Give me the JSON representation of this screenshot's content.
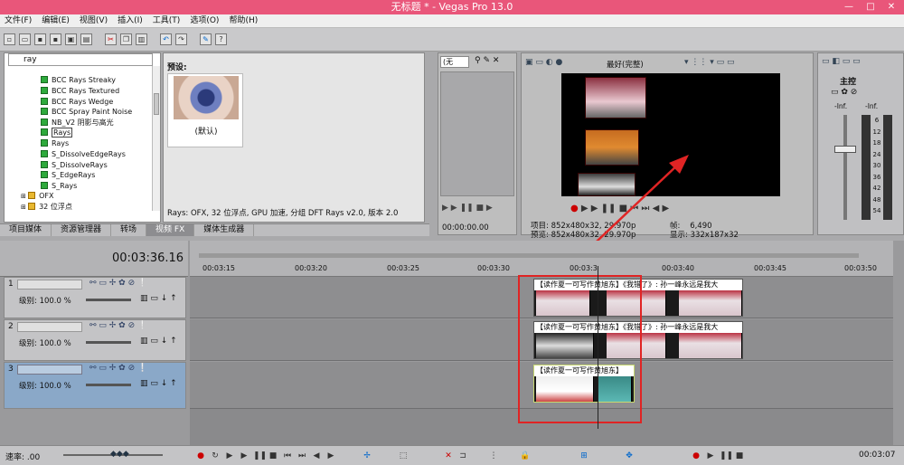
{
  "window": {
    "title": "无标题 * - Vegas Pro 13.0"
  },
  "menu": [
    "文件(F)",
    "编辑(E)",
    "视图(V)",
    "插入(I)",
    "工具(T)",
    "选项(O)",
    "帮助(H)"
  ],
  "explorer": {
    "search_value": "ray",
    "items": [
      "BCC Rays Streaky",
      "BCC Rays Textured",
      "BCC Rays Wedge",
      "BCC Spray Paint Noise",
      "NB_V2 阴影与高光",
      "Rays",
      "Rays",
      "S_DissolveEdgeRays",
      "S_DissolveRays",
      "S_EdgeRays",
      "S_Rays"
    ],
    "folders": [
      "OFX",
      "32 位浮点"
    ],
    "selected": "Rays"
  },
  "preset": {
    "header": "预设:",
    "thumb_label": "(默认)",
    "status": "Rays: OFX, 32 位浮点, GPU 加速, 分组 DFT Rays v2.0, 版本 2.0"
  },
  "tabs": [
    "项目媒体",
    "资源管理器",
    "转场",
    "视频 FX",
    "媒体生成器"
  ],
  "active_tab": "视频 FX",
  "trimmer": {
    "dropdown": "(无",
    "timecode": "00:00:00.00"
  },
  "preview": {
    "quality": "最好(完整)",
    "project_label": "项目:",
    "project_value": "852x480x32, 29.970p",
    "preview_label": "预览:",
    "preview_value": "852x480x32, 29.970p",
    "frame_label": "帧:",
    "frame_value": "6,490",
    "display_label": "显示:",
    "display_value": "332x187x32"
  },
  "mixer": {
    "title": "主控",
    "value1": "-Inf.",
    "value2": "-Inf.",
    "scale": [
      "6",
      "12",
      "18",
      "24",
      "30",
      "36",
      "42",
      "48",
      "54"
    ]
  },
  "timeline": {
    "timecode": "00:03:36.16",
    "ticks": [
      "00:03:15",
      "00:03:20",
      "00:03:25",
      "00:03:30",
      "00:03:3",
      "00:03:40",
      "00:03:45",
      "00:03:50"
    ],
    "tracks": [
      {
        "num": "1",
        "level": "级别: 100.0 %",
        "clip_title": "【读作夏一可写作黄旭东】《我错了》: 孙一峰永远是我大"
      },
      {
        "num": "2",
        "level": "级别: 100.0 %",
        "clip_title": "【读作夏一可写作黄旭东】《我错了》: 孙一峰永远是我大"
      },
      {
        "num": "3",
        "level": "级别: 100.0 %",
        "clip_title": "【读作夏一可写作黄旭东】"
      }
    ]
  },
  "bottom": {
    "rate": "速率: .00",
    "end_time": "00:03:07"
  },
  "colors": {
    "titlebar": "#e9567a",
    "highlight": "#e02424"
  }
}
